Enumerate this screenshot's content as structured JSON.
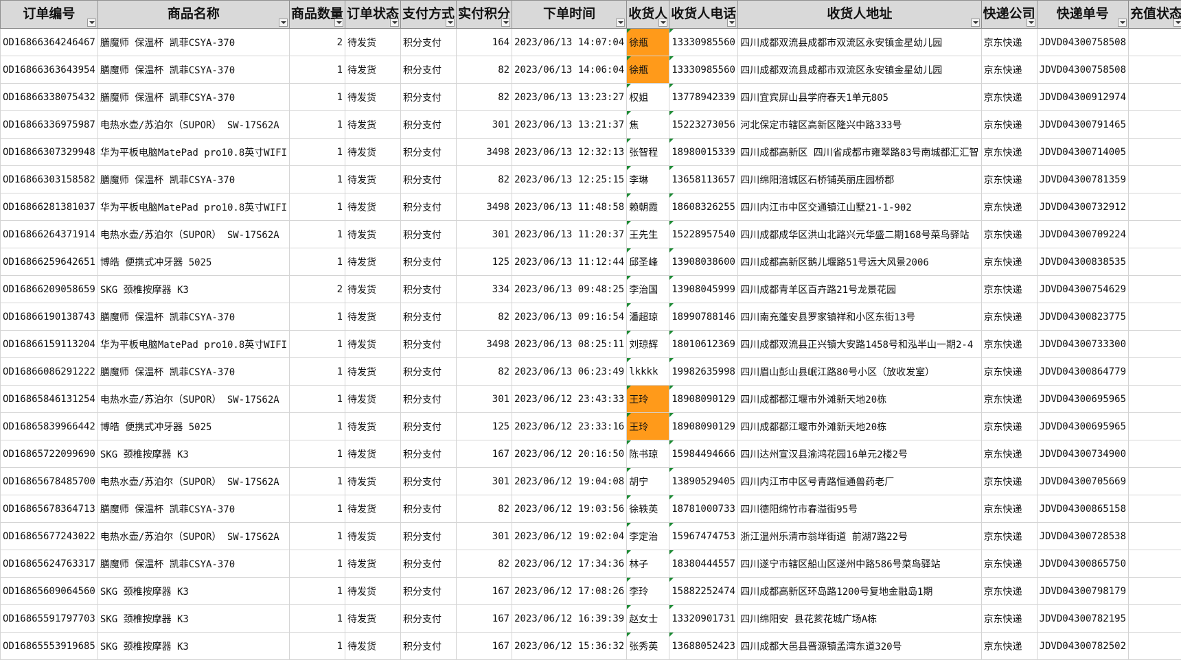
{
  "columns": [
    "订单编号",
    "商品名称",
    "商品数量",
    "订单状态",
    "支付方式",
    "实付积分",
    "下单时间",
    "收货人",
    "收货人电话",
    "收货人地址",
    "快递公司",
    "快递单号",
    "充值状态"
  ],
  "rows": [
    [
      "OD16866364246467",
      "膳魔师 保温杯 凯菲CSYA-370",
      "2",
      "待发货",
      "积分支付",
      "164",
      "2023/06/13 14:07:04",
      "徐瓶",
      "13330985560",
      "四川成都双流县成都市双流区永安镇金星幼儿园",
      "京东快递",
      "JDVD04300758508",
      ""
    ],
    [
      "OD16866363643954",
      "膳魔师 保温杯 凯菲CSYA-370",
      "1",
      "待发货",
      "积分支付",
      "82",
      "2023/06/13 14:06:04",
      "徐瓶",
      "13330985560",
      "四川成都双流县成都市双流区永安镇金星幼儿园",
      "京东快递",
      "JDVD04300758508",
      ""
    ],
    [
      "OD16866338075432",
      "膳魔师 保温杯 凯菲CSYA-370",
      "1",
      "待发货",
      "积分支付",
      "82",
      "2023/06/13 13:23:27",
      "权姐",
      "13778942339",
      "四川宜宾屏山县学府春天1单元805",
      "京东快递",
      "JDVD04300912974",
      ""
    ],
    [
      "OD16866336975987",
      "电热水壶/苏泊尔（SUPOR） SW-17S62A",
      "1",
      "待发货",
      "积分支付",
      "301",
      "2023/06/13 13:21:37",
      "焦",
      "15223273056",
      "河北保定市辖区高新区隆兴中路333号",
      "京东快递",
      "JDVD04300791465",
      ""
    ],
    [
      "OD16866307329948",
      "华为平板电脑MatePad pro10.8英寸WIFI",
      "1",
      "待发货",
      "积分支付",
      "3498",
      "2023/06/13 12:32:13",
      "张智程",
      "18980015339",
      "四川成都高新区 四川省成都市雍翠路83号南城都汇汇智",
      "京东快递",
      "JDVD04300714005",
      ""
    ],
    [
      "OD16866303158582",
      "膳魔师 保温杯 凯菲CSYA-370",
      "1",
      "待发货",
      "积分支付",
      "82",
      "2023/06/13 12:25:15",
      "李琳",
      "13658113657",
      "四川绵阳涪城区石桥铺英丽庄园桥郡",
      "京东快递",
      "JDVD04300781359",
      ""
    ],
    [
      "OD16866281381037",
      "华为平板电脑MatePad pro10.8英寸WIFI",
      "1",
      "待发货",
      "积分支付",
      "3498",
      "2023/06/13 11:48:58",
      "赖朝霞",
      "18608326255",
      "四川内江市中区交通镇江山墅21-1-902",
      "京东快递",
      "JDVD04300732912",
      ""
    ],
    [
      "OD16866264371914",
      "电热水壶/苏泊尔（SUPOR） SW-17S62A",
      "1",
      "待发货",
      "积分支付",
      "301",
      "2023/06/13 11:20:37",
      "王先生",
      "15228957540",
      "四川成都成华区洪山北路兴元华盛二期168号菜鸟驿站",
      "京东快递",
      "JDVD04300709224",
      ""
    ],
    [
      "OD16866259642651",
      "博皓 便携式冲牙器 5025",
      "1",
      "待发货",
      "积分支付",
      "125",
      "2023/06/13 11:12:44",
      "邱圣峰",
      "13908038600",
      "四川成都高新区鹅儿堰路51号远大风景2006",
      "京东快递",
      "JDVD04300838535",
      ""
    ],
    [
      "OD16866209058659",
      "SKG 颈椎按摩器 K3",
      "2",
      "待发货",
      "积分支付",
      "334",
      "2023/06/13 09:48:25",
      "李治国",
      "13908045999",
      "四川成都青羊区百卉路21号龙景花园",
      "京东快递",
      "JDVD04300754629",
      ""
    ],
    [
      "OD16866190138743",
      "膳魔师 保温杯 凯菲CSYA-370",
      "1",
      "待发货",
      "积分支付",
      "82",
      "2023/06/13 09:16:54",
      "潘超琼",
      "18990788146",
      "四川南充蓬安县罗家镇祥和小区东街13号",
      "京东快递",
      "JDVD04300823775",
      ""
    ],
    [
      "OD16866159113204",
      "华为平板电脑MatePad pro10.8英寸WIFI",
      "1",
      "待发货",
      "积分支付",
      "3498",
      "2023/06/13 08:25:11",
      "刘琼辉",
      "18010612369",
      "四川成都双流县正兴镇大安路1458号和泓半山一期2-4",
      "京东快递",
      "JDVD04300733300",
      ""
    ],
    [
      "OD16866086291222",
      "膳魔师 保温杯 凯菲CSYA-370",
      "1",
      "待发货",
      "积分支付",
      "82",
      "2023/06/13 06:23:49",
      "lkkkk",
      "19982635998",
      "四川眉山彭山县岷江路80号小区（放收发室）",
      "京东快递",
      "JDVD04300864779",
      ""
    ],
    [
      "OD16865846131254",
      "电热水壶/苏泊尔（SUPOR） SW-17S62A",
      "1",
      "待发货",
      "积分支付",
      "301",
      "2023/06/12 23:43:33",
      "王玲",
      "18908090129",
      "四川成都都江堰市外滩新天地20栋",
      "京东快递",
      "JDVD04300695965",
      ""
    ],
    [
      "OD16865839966442",
      "博皓 便携式冲牙器 5025",
      "1",
      "待发货",
      "积分支付",
      "125",
      "2023/06/12 23:33:16",
      "王玲",
      "18908090129",
      "四川成都都江堰市外滩新天地20栋",
      "京东快递",
      "JDVD04300695965",
      ""
    ],
    [
      "OD16865722099690",
      "SKG 颈椎按摩器 K3",
      "1",
      "待发货",
      "积分支付",
      "167",
      "2023/06/12 20:16:50",
      "陈书琼",
      "15984494666",
      "四川达州宣汉县渝鸿花园16单元2楼2号",
      "京东快递",
      "JDVD04300734900",
      ""
    ],
    [
      "OD16865678485700",
      "电热水壶/苏泊尔（SUPOR） SW-17S62A",
      "1",
      "待发货",
      "积分支付",
      "301",
      "2023/06/12 19:04:08",
      "胡宁",
      "13890529405",
      "四川内江市中区号青路恒通兽药老厂",
      "京东快递",
      "JDVD04300705669",
      ""
    ],
    [
      "OD16865678364713",
      "膳魔师 保温杯 凯菲CSYA-370",
      "1",
      "待发货",
      "积分支付",
      "82",
      "2023/06/12 19:03:56",
      "徐轶英",
      "18781000733",
      "四川德阳绵竹市春溢街95号",
      "京东快递",
      "JDVD04300865158",
      ""
    ],
    [
      "OD16865677243022",
      "电热水壶/苏泊尔（SUPOR） SW-17S62A",
      "1",
      "待发货",
      "积分支付",
      "301",
      "2023/06/12 19:02:04",
      "李定治",
      "15967474753",
      "浙江温州乐清市翁垟街道 前湖7路22号",
      "京东快递",
      "JDVD04300728538",
      ""
    ],
    [
      "OD16865624763317",
      "膳魔师 保温杯 凯菲CSYA-370",
      "1",
      "待发货",
      "积分支付",
      "82",
      "2023/06/12 17:34:36",
      "林子",
      "18380444557",
      "四川遂宁市辖区船山区遂州中路586号菜鸟驿站",
      "京东快递",
      "JDVD04300865750",
      ""
    ],
    [
      "OD16865609064560",
      "SKG 颈椎按摩器 K3",
      "1",
      "待发货",
      "积分支付",
      "167",
      "2023/06/12 17:08:26",
      "李玲",
      "15882252474",
      "四川成都高新区环岛路1200号复地金融岛1期",
      "京东快递",
      "JDVD04300798179",
      ""
    ],
    [
      "OD16865591797703",
      "SKG 颈椎按摩器 K3",
      "1",
      "待发货",
      "积分支付",
      "167",
      "2023/06/12 16:39:39",
      "赵女士",
      "13320901731",
      "四川绵阳安 县花荄花城广场A栋",
      "京东快递",
      "JDVD04300782195",
      ""
    ],
    [
      "OD16865553919685",
      "SKG 颈椎按摩器 K3",
      "1",
      "待发货",
      "积分支付",
      "167",
      "2023/06/12 15:36:32",
      "张秀英",
      "13688052423",
      "四川成都大邑县晋源镇孟湾东道320号",
      "京东快递",
      "JDVD04300782502",
      ""
    ]
  ],
  "highlighted_rows": [
    0,
    1,
    13,
    14
  ],
  "highlight_column": 7,
  "numeric_columns": [
    2,
    5
  ],
  "comment_marker_columns": [
    7,
    8
  ],
  "colors": {
    "highlight": "#ff9a1a",
    "header_bg": "#d9d9d9",
    "comment_marker": "#1a8a32"
  }
}
